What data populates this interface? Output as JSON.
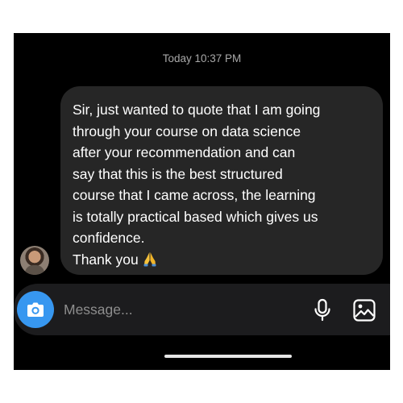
{
  "chat": {
    "timestamp": "Today 10:37 PM",
    "message": {
      "lines": [
        "Sir, just wanted to quote that I am going",
        "through your course on data science",
        "after your recommendation and can",
        "say that this is the best structured",
        "course that I came across, the learning",
        "is totally practical based which gives us",
        "confidence."
      ],
      "closing": "Thank you",
      "emoji": "folded-hands-icon"
    }
  },
  "composer": {
    "placeholder": "Message...",
    "camera_icon": "camera-icon",
    "mic_icon": "microphone-icon",
    "gallery_icon": "gallery-icon",
    "accent": "#3797f0"
  }
}
